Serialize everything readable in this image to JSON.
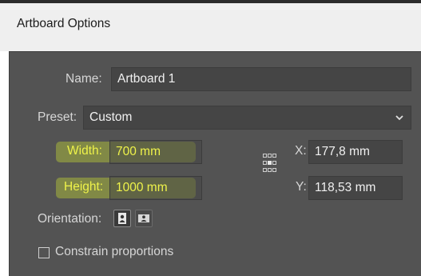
{
  "dialog": {
    "title": "Artboard Options"
  },
  "name": {
    "label": "Name:",
    "value": "Artboard 1"
  },
  "preset": {
    "label": "Preset:",
    "value": "Custom"
  },
  "size": {
    "width_label": "Width:",
    "width_value": "700 mm",
    "height_label": "Height:",
    "height_value": "1000 mm"
  },
  "position": {
    "x_label": "X:",
    "x_value": "177,8 mm",
    "y_label": "Y:",
    "y_value": "118,53 mm"
  },
  "orientation": {
    "label": "Orientation:",
    "selected": "portrait"
  },
  "constrain": {
    "label": "Constrain proportions",
    "checked": false
  },
  "colors": {
    "panel": "#535353",
    "highlight": "#eef24a"
  }
}
